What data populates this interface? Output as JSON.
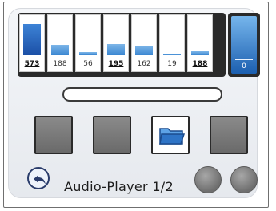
{
  "equalizer": {
    "bands": [
      {
        "value": "573",
        "level": 0.85,
        "emphasis": true
      },
      {
        "value": "188",
        "level": 0.28,
        "emphasis": false
      },
      {
        "value": "56",
        "level": 0.08,
        "emphasis": false
      },
      {
        "value": "195",
        "level": 0.3,
        "emphasis": true
      },
      {
        "value": "162",
        "level": 0.25,
        "emphasis": false
      },
      {
        "value": "19",
        "level": 0.04,
        "emphasis": false
      },
      {
        "value": "188",
        "level": 0.1,
        "emphasis": true
      }
    ],
    "master": {
      "value": "0"
    }
  },
  "player": {
    "title": "Audio-Player 1/2",
    "progress": 0
  },
  "buttons": [
    {
      "name": "button-1",
      "icon": "",
      "active": false
    },
    {
      "name": "button-2",
      "icon": "",
      "active": false
    },
    {
      "name": "open-folder-button",
      "icon": "folder-icon",
      "active": true
    },
    {
      "name": "button-4",
      "icon": "",
      "active": false
    }
  ],
  "colors": {
    "accent_blue": "#3a86d1",
    "dark": "#2a2a2a",
    "button_gray": "#7a7a7a"
  },
  "icons": [
    "back-arrow-icon",
    "folder-icon"
  ]
}
